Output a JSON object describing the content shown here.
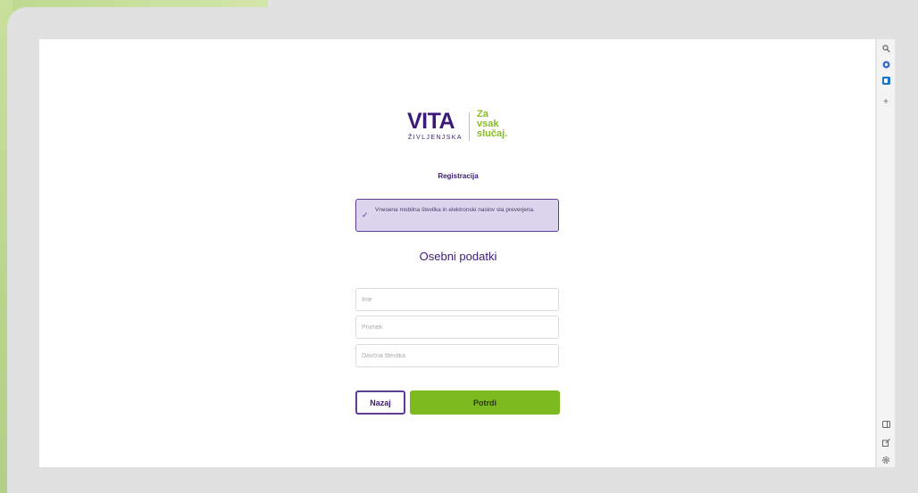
{
  "brand": {
    "name": "VITA",
    "subtitle": "ŽIVLJENJSKA",
    "tagline": [
      "Za",
      "vsak",
      "slučaj."
    ],
    "colors": {
      "primary": "#3b1a7a",
      "accent": "#7cba1d"
    }
  },
  "form": {
    "title": "Registracija",
    "alert": {
      "icon": "check-icon",
      "text": "Vnesena mobilna številka in elektronski naslov sta preverjena."
    },
    "section_title": "Osebni podatki",
    "fields": {
      "first_name": {
        "placeholder": "Ime",
        "value": ""
      },
      "last_name": {
        "placeholder": "Priimek",
        "value": ""
      },
      "tax_number": {
        "placeholder": "Davčna številka",
        "value": ""
      }
    },
    "buttons": {
      "back": "Nazaj",
      "confirm": "Potrdi"
    }
  },
  "browser_sidebar": {
    "icons": [
      "search-icon",
      "extension-icon",
      "outlook-icon",
      "add-icon",
      "sidebar-toggle-icon",
      "external-link-icon",
      "settings-icon"
    ]
  }
}
